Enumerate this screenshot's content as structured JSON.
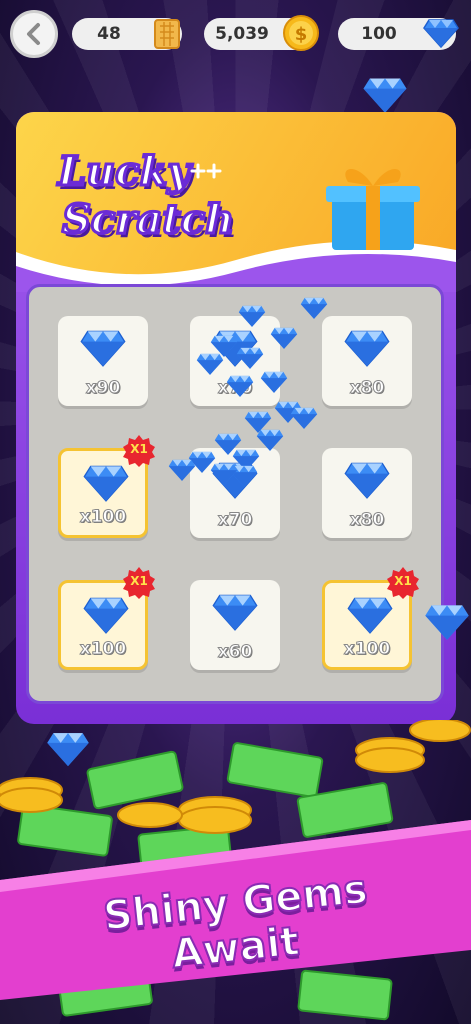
{
  "header": {
    "tickets": "48",
    "coins": "5,039",
    "gems": "100"
  },
  "game": {
    "title_line1": "Lucky",
    "title_line2": "Scratch",
    "cells": [
      {
        "label": "x90",
        "highlight": false,
        "badge": ""
      },
      {
        "label": "x70",
        "highlight": false,
        "badge": ""
      },
      {
        "label": "x80",
        "highlight": false,
        "badge": ""
      },
      {
        "label": "x100",
        "highlight": true,
        "badge": "X1"
      },
      {
        "label": "x70",
        "highlight": false,
        "badge": ""
      },
      {
        "label": "x80",
        "highlight": false,
        "badge": ""
      },
      {
        "label": "x100",
        "highlight": true,
        "badge": "X1"
      },
      {
        "label": "x60",
        "highlight": false,
        "badge": ""
      },
      {
        "label": "x100",
        "highlight": true,
        "badge": "X1"
      }
    ]
  },
  "promo": {
    "line1": "Shiny Gems",
    "line2": "Await"
  },
  "colors": {
    "banner": "#fdd54a",
    "card": "#8b45e3",
    "gem": "#3c8cf5",
    "promo": "#e33fcf"
  }
}
